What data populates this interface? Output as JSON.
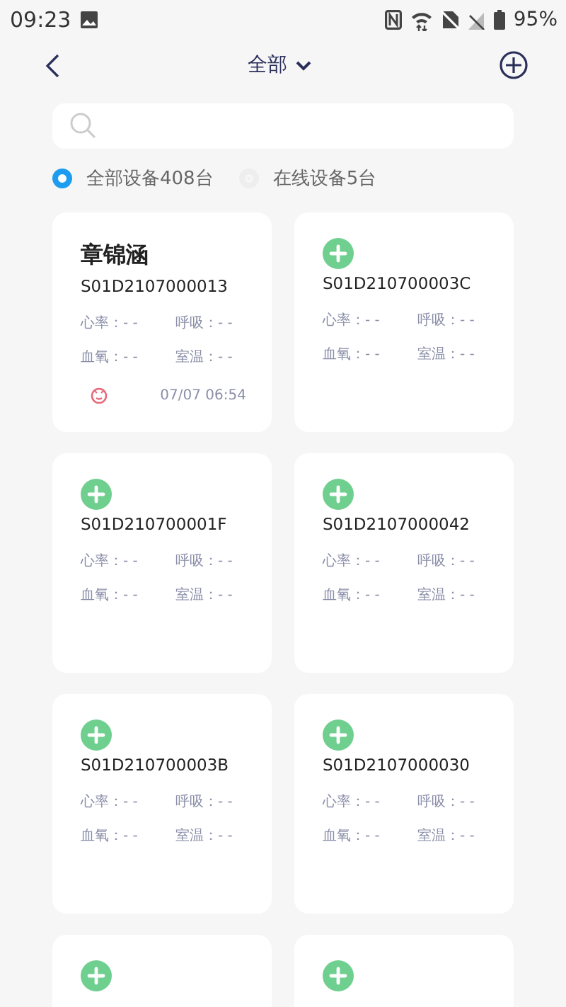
{
  "status_bar": {
    "time": "09:23",
    "battery": "95%"
  },
  "header": {
    "title": "全部"
  },
  "filters": [
    {
      "label": "全部设备408台",
      "selected": true
    },
    {
      "label": "在线设备5台",
      "selected": false
    }
  ],
  "devices": [
    {
      "kind": "bound",
      "name": "章锦涵",
      "serial": "S01D2107000013",
      "metrics": [
        "心率：- -",
        "呼吸：- -",
        "血氧：- -",
        "室温：- -"
      ],
      "time": "07/07 06:54"
    },
    {
      "kind": "new",
      "serial": "S01D210700003C",
      "metrics": [
        "心率：- -",
        "呼吸：- -",
        "血氧：- -",
        "室温：- -"
      ]
    },
    {
      "kind": "new",
      "serial": "S01D210700001F",
      "metrics": [
        "心率：- -",
        "呼吸：- -",
        "血氧：- -",
        "室温：- -"
      ]
    },
    {
      "kind": "new",
      "serial": "S01D2107000042",
      "metrics": [
        "心率：- -",
        "呼吸：- -",
        "血氧：- -",
        "室温：- -"
      ]
    },
    {
      "kind": "new",
      "serial": "S01D210700003B",
      "metrics": [
        "心率：- -",
        "呼吸：- -",
        "血氧：- -",
        "室温：- -"
      ]
    },
    {
      "kind": "new",
      "serial": "S01D2107000030",
      "metrics": [
        "心率：- -",
        "呼吸：- -",
        "血氧：- -",
        "室温：- -"
      ]
    },
    {
      "kind": "new"
    },
    {
      "kind": "new"
    }
  ]
}
